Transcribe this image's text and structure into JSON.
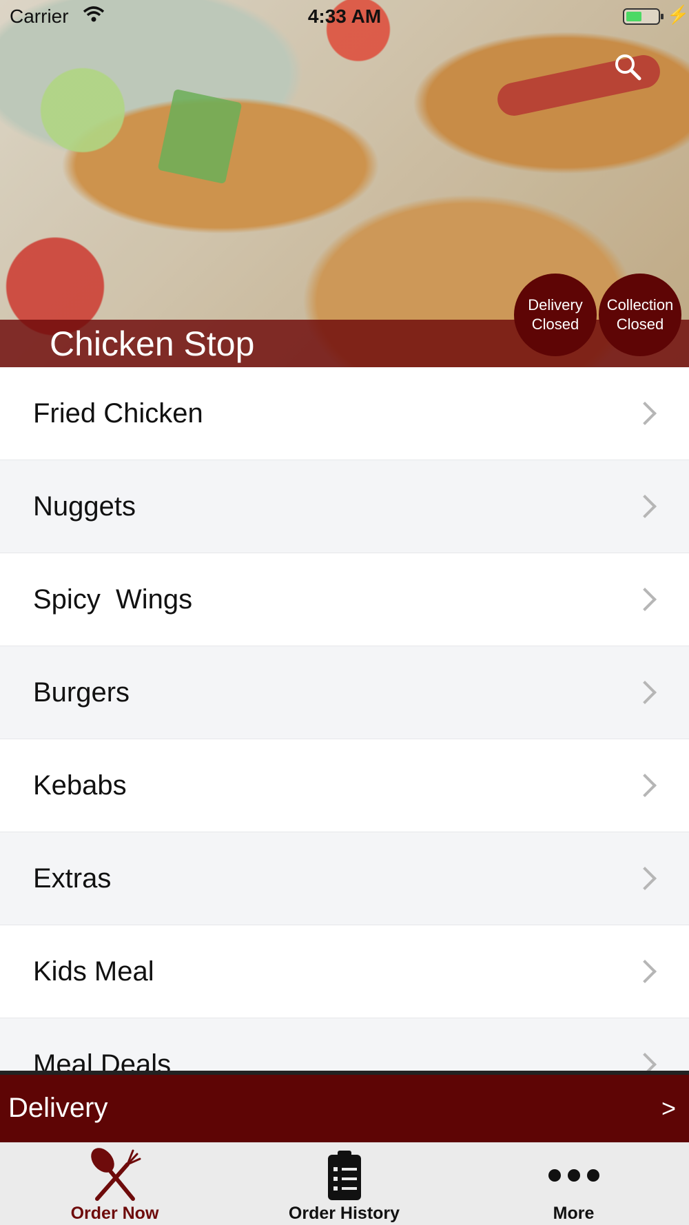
{
  "status_bar": {
    "carrier": "Carrier",
    "time": "4:33 AM"
  },
  "header": {
    "restaurant_name": "Chicken Stop",
    "delivery_status": {
      "line1": "Delivery",
      "line2": "Closed"
    },
    "collection_status": {
      "line1": "Collection",
      "line2": "Closed"
    },
    "icons": {
      "search": "search-icon",
      "wifi": "wifi-icon",
      "battery": "battery-icon"
    }
  },
  "menu": {
    "items": [
      {
        "label": "Fried Chicken"
      },
      {
        "label": "Nuggets"
      },
      {
        "label": "Spicy  Wings"
      },
      {
        "label": "Burgers"
      },
      {
        "label": "Kebabs"
      },
      {
        "label": "Extras"
      },
      {
        "label": "Kids Meal"
      },
      {
        "label": "Meal Deals"
      }
    ]
  },
  "delivery_bar": {
    "label": "Delivery",
    "arrow": ">"
  },
  "tab_bar": {
    "tabs": [
      {
        "label": "Order Now",
        "icon": "fork-knife-icon",
        "active": true
      },
      {
        "label": "Order History",
        "icon": "clipboard-icon",
        "active": false
      },
      {
        "label": "More",
        "icon": "more-dots-icon",
        "active": false
      }
    ]
  },
  "colors": {
    "brand": "#5e0505",
    "active_tab": "#6e0b0b",
    "alt_row": "#f4f5f7",
    "tab_bar_bg": "#ebebeb"
  }
}
